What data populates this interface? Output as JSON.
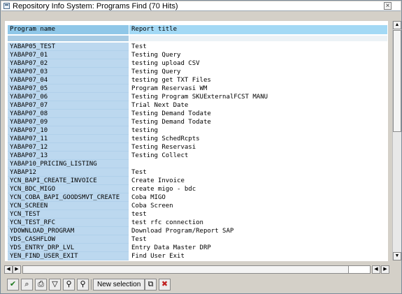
{
  "window": {
    "title": "Repository Info System: Programs Find (70 Hits)",
    "close_label": "×"
  },
  "table": {
    "columns": [
      "Program name",
      "Report title"
    ],
    "rows": [
      {
        "program": "YABAP05_TEST",
        "title": "Test"
      },
      {
        "program": "YABAP07_01",
        "title": "Testing Query"
      },
      {
        "program": "YABAP07_02",
        "title": "testing upload CSV"
      },
      {
        "program": "YABAP07_03",
        "title": "Testing Query"
      },
      {
        "program": "YABAP07_04",
        "title": "testing get TXT Files"
      },
      {
        "program": "YABAP07_05",
        "title": "Program Reservasi WM"
      },
      {
        "program": "YABAP07_06",
        "title": "Testing Program SKUExternalFCST MANU"
      },
      {
        "program": "YABAP07_07",
        "title": "Trial Next Date"
      },
      {
        "program": "YABAP07_08",
        "title": "Testing Demand Todate"
      },
      {
        "program": "YABAP07_09",
        "title": "Testing Demand Todate"
      },
      {
        "program": "YABAP07_10",
        "title": "testing"
      },
      {
        "program": "YABAP07_11",
        "title": "testing SchedRcpts"
      },
      {
        "program": "YABAP07_12",
        "title": "Testing Reservasi"
      },
      {
        "program": "YABAP07_13",
        "title": "Testing Collect"
      },
      {
        "program": "YABAP10_PRICING_LISTING",
        "title": ""
      },
      {
        "program": "YABAP12",
        "title": "Test"
      },
      {
        "program": "YCN_BAPI_CREATE_INVOICE",
        "title": "Create Invoice"
      },
      {
        "program": "YCN_BDC_MIGO",
        "title": "create migo - bdc"
      },
      {
        "program": "YCN_COBA_BAPI_GOODSMVT_CREATE",
        "title": "Coba MIGO"
      },
      {
        "program": "YCN_SCREEN",
        "title": "Coba Screen"
      },
      {
        "program": "YCN_TEST",
        "title": "test"
      },
      {
        "program": "YCN_TEST_RFC",
        "title": "test rfc connection"
      },
      {
        "program": "YDOWNLOAD_PROGRAM",
        "title": "Download Program/Report SAP"
      },
      {
        "program": "YDS_CASHFLOW",
        "title": "Test"
      },
      {
        "program": "YDS_ENTRY_DRP_LVL",
        "title": "Entry Data Master DRP"
      },
      {
        "program": "YEN_FIND_USER_EXIT",
        "title": "Find User Exit"
      }
    ]
  },
  "scrollbars": {
    "up": "▲",
    "down": "▼",
    "left": "◀",
    "right": "▶"
  },
  "toolbar": {
    "continue_icon": "✔",
    "find_icon": "⌕",
    "print_icon": "⎙",
    "filter_icon": "▽",
    "binoculars_icon": "⚲",
    "binoculars_next_icon": "⚲",
    "new_selection_label": "New selection",
    "copy_icon": "⧉",
    "cancel_icon": "✖",
    "cancel_color": "#c02020",
    "continue_color": "#1f7a1f"
  }
}
